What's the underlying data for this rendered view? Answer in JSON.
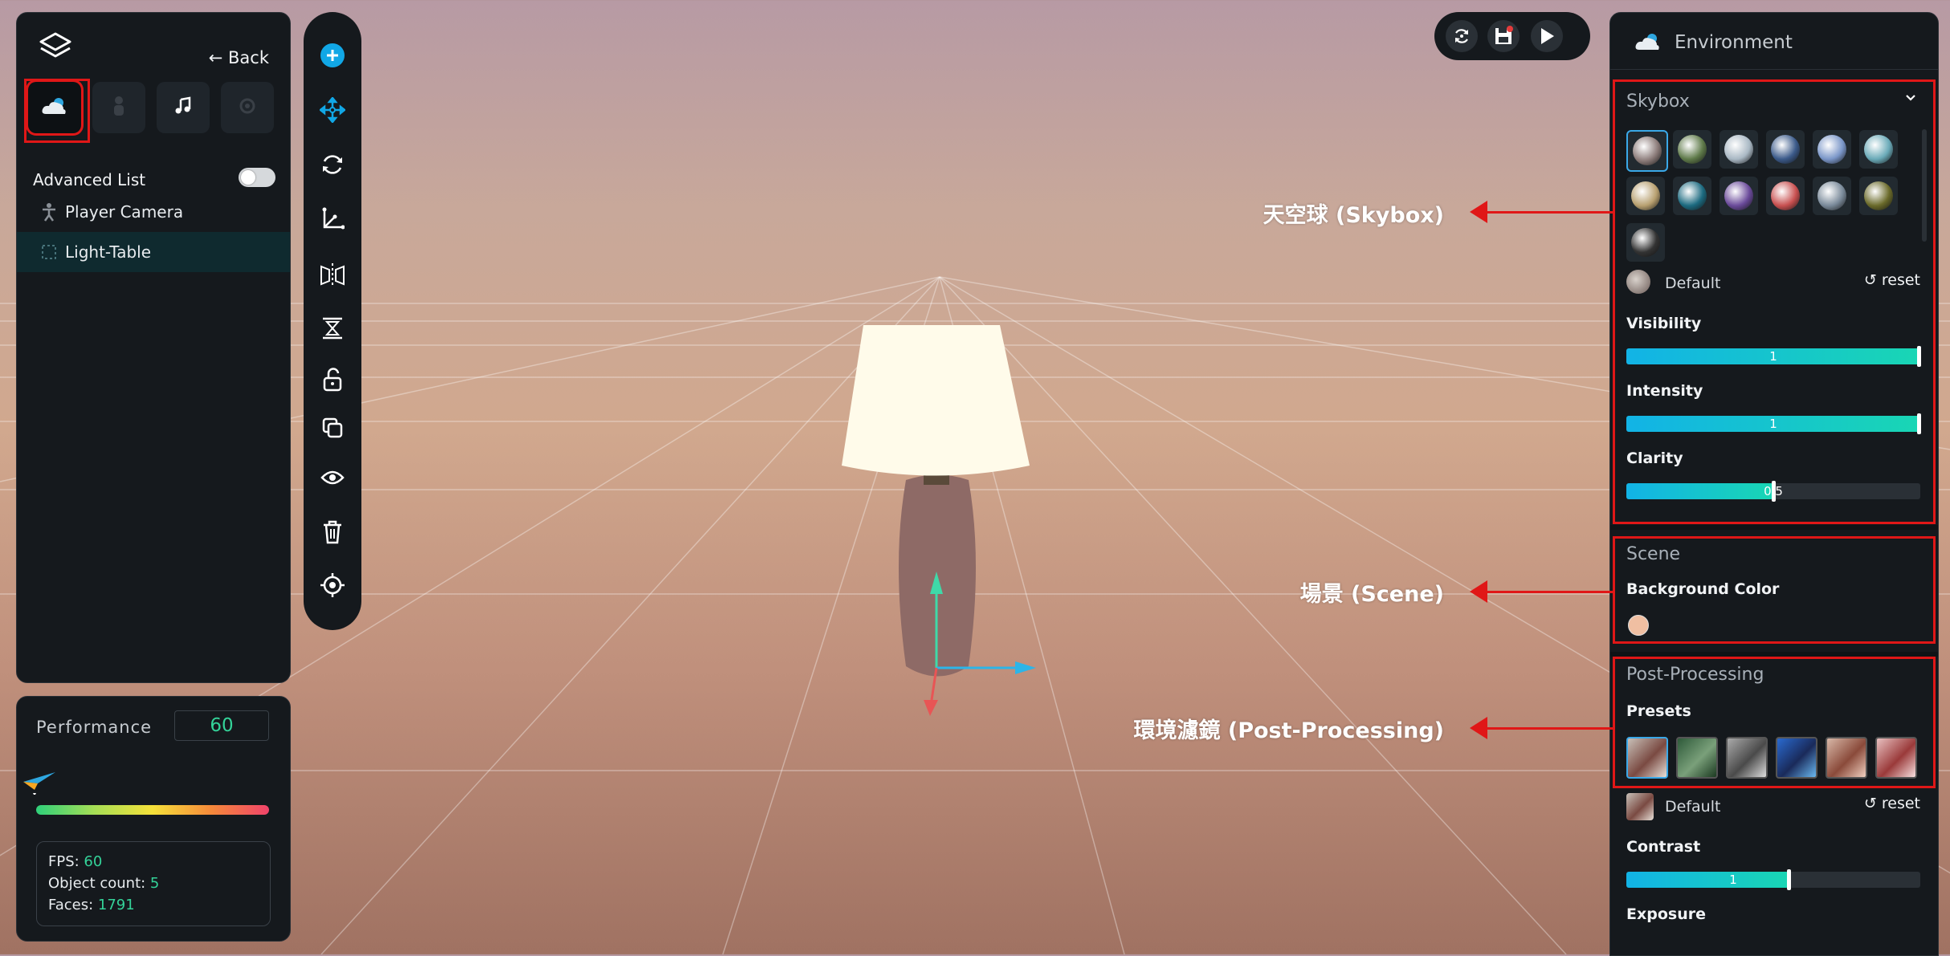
{
  "left_panel": {
    "back_label": "← Back",
    "advanced_list_label": "Advanced List",
    "advanced_list_on": false,
    "tree": [
      {
        "label": "Player Camera",
        "icon": "person-icon",
        "selected": false
      },
      {
        "label": "Light-Table",
        "icon": "object-dashed-icon",
        "selected": true
      }
    ],
    "category_tabs": [
      "environment-cloud-icon",
      "person-icon",
      "music-note-icon",
      "effects-icon"
    ]
  },
  "performance": {
    "title": "Performance",
    "value": "60",
    "fps_label": "FPS: ",
    "fps_value": "60",
    "object_count_label": "Object count: ",
    "object_count_value": "5",
    "faces_label": "Faces: ",
    "faces_value": "1791"
  },
  "toolbar": [
    "add-icon",
    "move-icon",
    "rotate-icon",
    "axis-icon",
    "mirror-icon",
    "align-icon",
    "unlock-icon",
    "duplicate-icon",
    "eye-icon",
    "trash-icon",
    "target-icon"
  ],
  "top_controls": [
    "refresh-icon",
    "save-icon",
    "play-icon"
  ],
  "environment": {
    "title": "Environment",
    "skybox": {
      "title": "Skybox",
      "selected_name": "Default",
      "reset_label": "reset",
      "visibility_label": "Visibility",
      "visibility_value": "1",
      "intensity_label": "Intensity",
      "intensity_value": "1",
      "clarity_label": "Clarity",
      "clarity_value": "0.5",
      "thumb_colors": [
        "#8a7a78",
        "#5f7a4a",
        "#a9b8c4",
        "#3b5a8a",
        "#7a96c8",
        "#6aaab8",
        "#b8a070",
        "#1c6a80",
        "#6a4a9a",
        "#c85050",
        "#7a8a9a",
        "#6a6a2a",
        "#333333"
      ]
    },
    "scene": {
      "title": "Scene",
      "background_color_label": "Background Color",
      "background_color": "#f0bfa2"
    },
    "post_processing": {
      "title": "Post-Processing",
      "presets_label": "Presets",
      "selected_name": "Default",
      "reset_label": "reset",
      "contrast_label": "Contrast",
      "contrast_value": "1",
      "exposure_label": "Exposure"
    }
  },
  "annotations": {
    "skybox": "天空球 (Skybox)",
    "scene": "場景 (Scene)",
    "post_processing": "環境濾鏡 (Post-Processing)"
  }
}
